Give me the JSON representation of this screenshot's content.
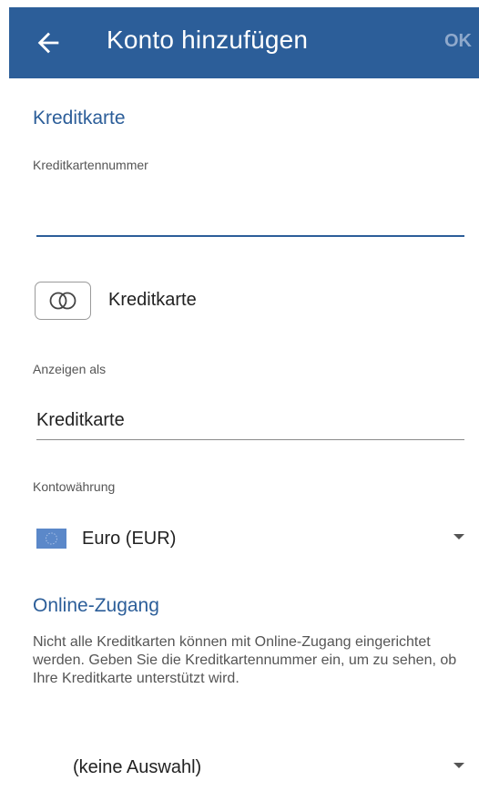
{
  "appbar": {
    "title": "Konto hinzufügen",
    "ok_label": "OK",
    "back_icon": "arrow-left-icon",
    "color": "#2c5e99"
  },
  "credit_card_section": {
    "title": "Kreditkarte",
    "number_label": "Kreditkartennummer",
    "number_value": "",
    "card_icon": "credit-card-icon",
    "card_type_label": "Kreditkarte"
  },
  "display_as": {
    "label": "Anzeigen als",
    "value": "Kreditkarte"
  },
  "currency": {
    "label": "Kontowährung",
    "value": "Euro (EUR)",
    "flag_icon": "eu-flag-icon"
  },
  "online_access": {
    "title": "Online-Zugang",
    "description": "Nicht alle Kreditkarten können mit Online-Zugang eingerichtet werden. Geben Sie die Kreditkartennummer ein, um zu sehen, ob Ihre Kreditkarte unterstützt wird.",
    "selection_value": "(keine Auswahl)"
  }
}
